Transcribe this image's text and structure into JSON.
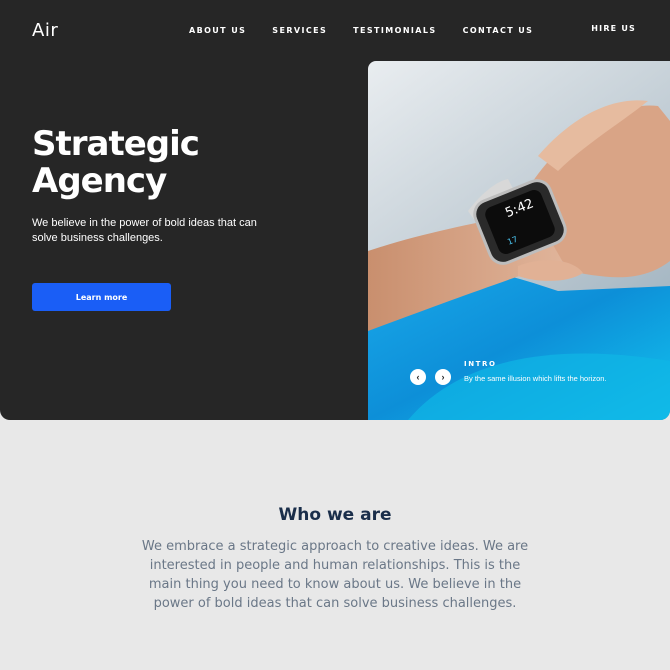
{
  "header": {
    "logo": "Air",
    "nav": [
      "ABOUT US",
      "SERVICES",
      "TESTIMONIALS",
      "CONTACT US"
    ],
    "hire": "HIRE US"
  },
  "hero": {
    "title": "Strategic Agency",
    "description": "We believe in the power of bold ideas that can solve business challenges.",
    "cta": "Learn more"
  },
  "slider": {
    "label": "INTRO",
    "text": "By the same illusion which lifts the horizon.",
    "prev_icon": "chevron-left-icon",
    "next_icon": "chevron-right-icon",
    "watch_time": "5:42",
    "watch_value": "17"
  },
  "about": {
    "title": "Who we are",
    "text": "We embrace a strategic approach to creative ideas. We are interested in people and human relationships. This is the main thing you need to know about us. We believe in the power of bold ideas that can solve business challenges."
  },
  "colors": {
    "hero_bg": "#262626",
    "accent": "#1a5ef6",
    "page_bg": "#e8e8e8",
    "heading": "#1a2e4a",
    "body_text": "#6a7787"
  }
}
